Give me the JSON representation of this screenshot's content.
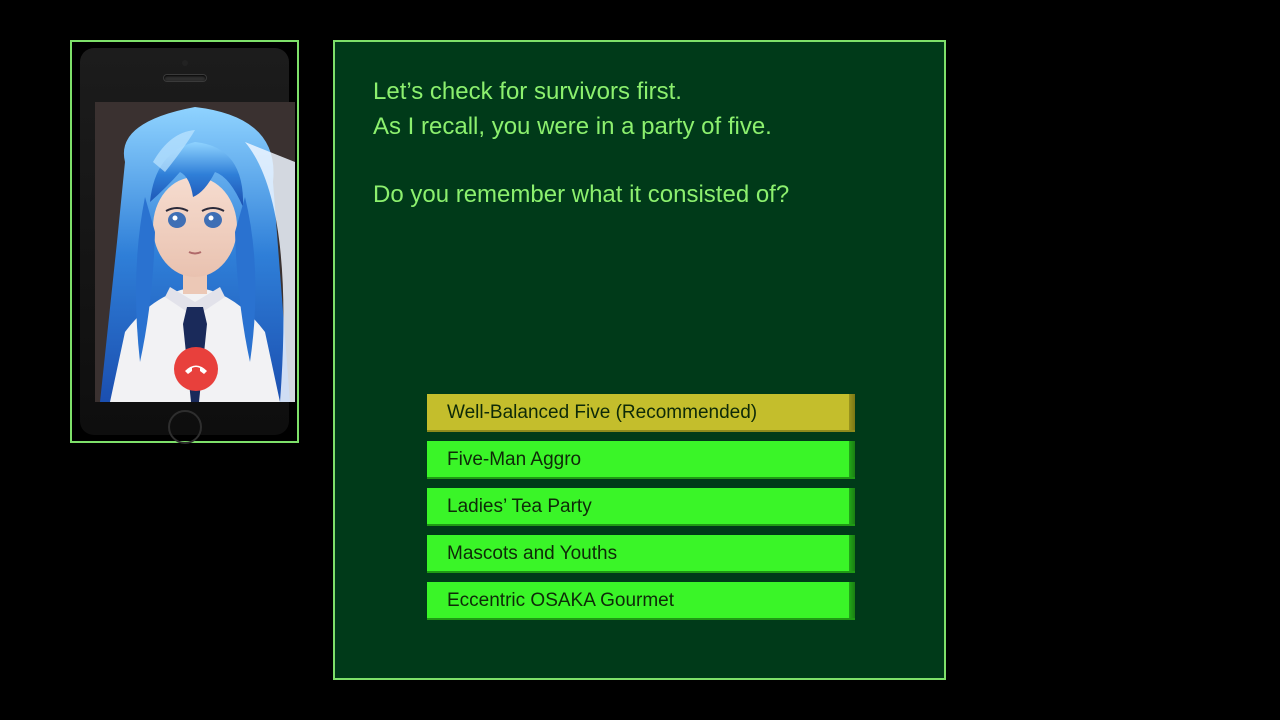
{
  "dialogue": {
    "line1": "Let’s check for survivors first.",
    "line2": "As I recall, you were in a party of five.",
    "line3": "Do you remember what it consisted of?"
  },
  "choices": [
    {
      "label": "Well-Balanced Five (Recommended)",
      "selected": true
    },
    {
      "label": "Five-Man Aggro",
      "selected": false
    },
    {
      "label": "Ladies’ Tea Party",
      "selected": false
    },
    {
      "label": "Mascots and Youths",
      "selected": false
    },
    {
      "label": "Eccentric OSAKA Gourmet",
      "selected": false
    }
  ],
  "phone": {
    "caller_portrait": "anime-girl-blue-hair-portrait",
    "end_call_icon": "phone-hangup-icon"
  },
  "colors": {
    "frame": "#7ee06a",
    "panel_bg": "#003a19",
    "dialogue_text": "#8cf06e",
    "choice_bg": "#3af528",
    "choice_selected_bg": "#c4be2c",
    "end_call": "#e8403c"
  }
}
